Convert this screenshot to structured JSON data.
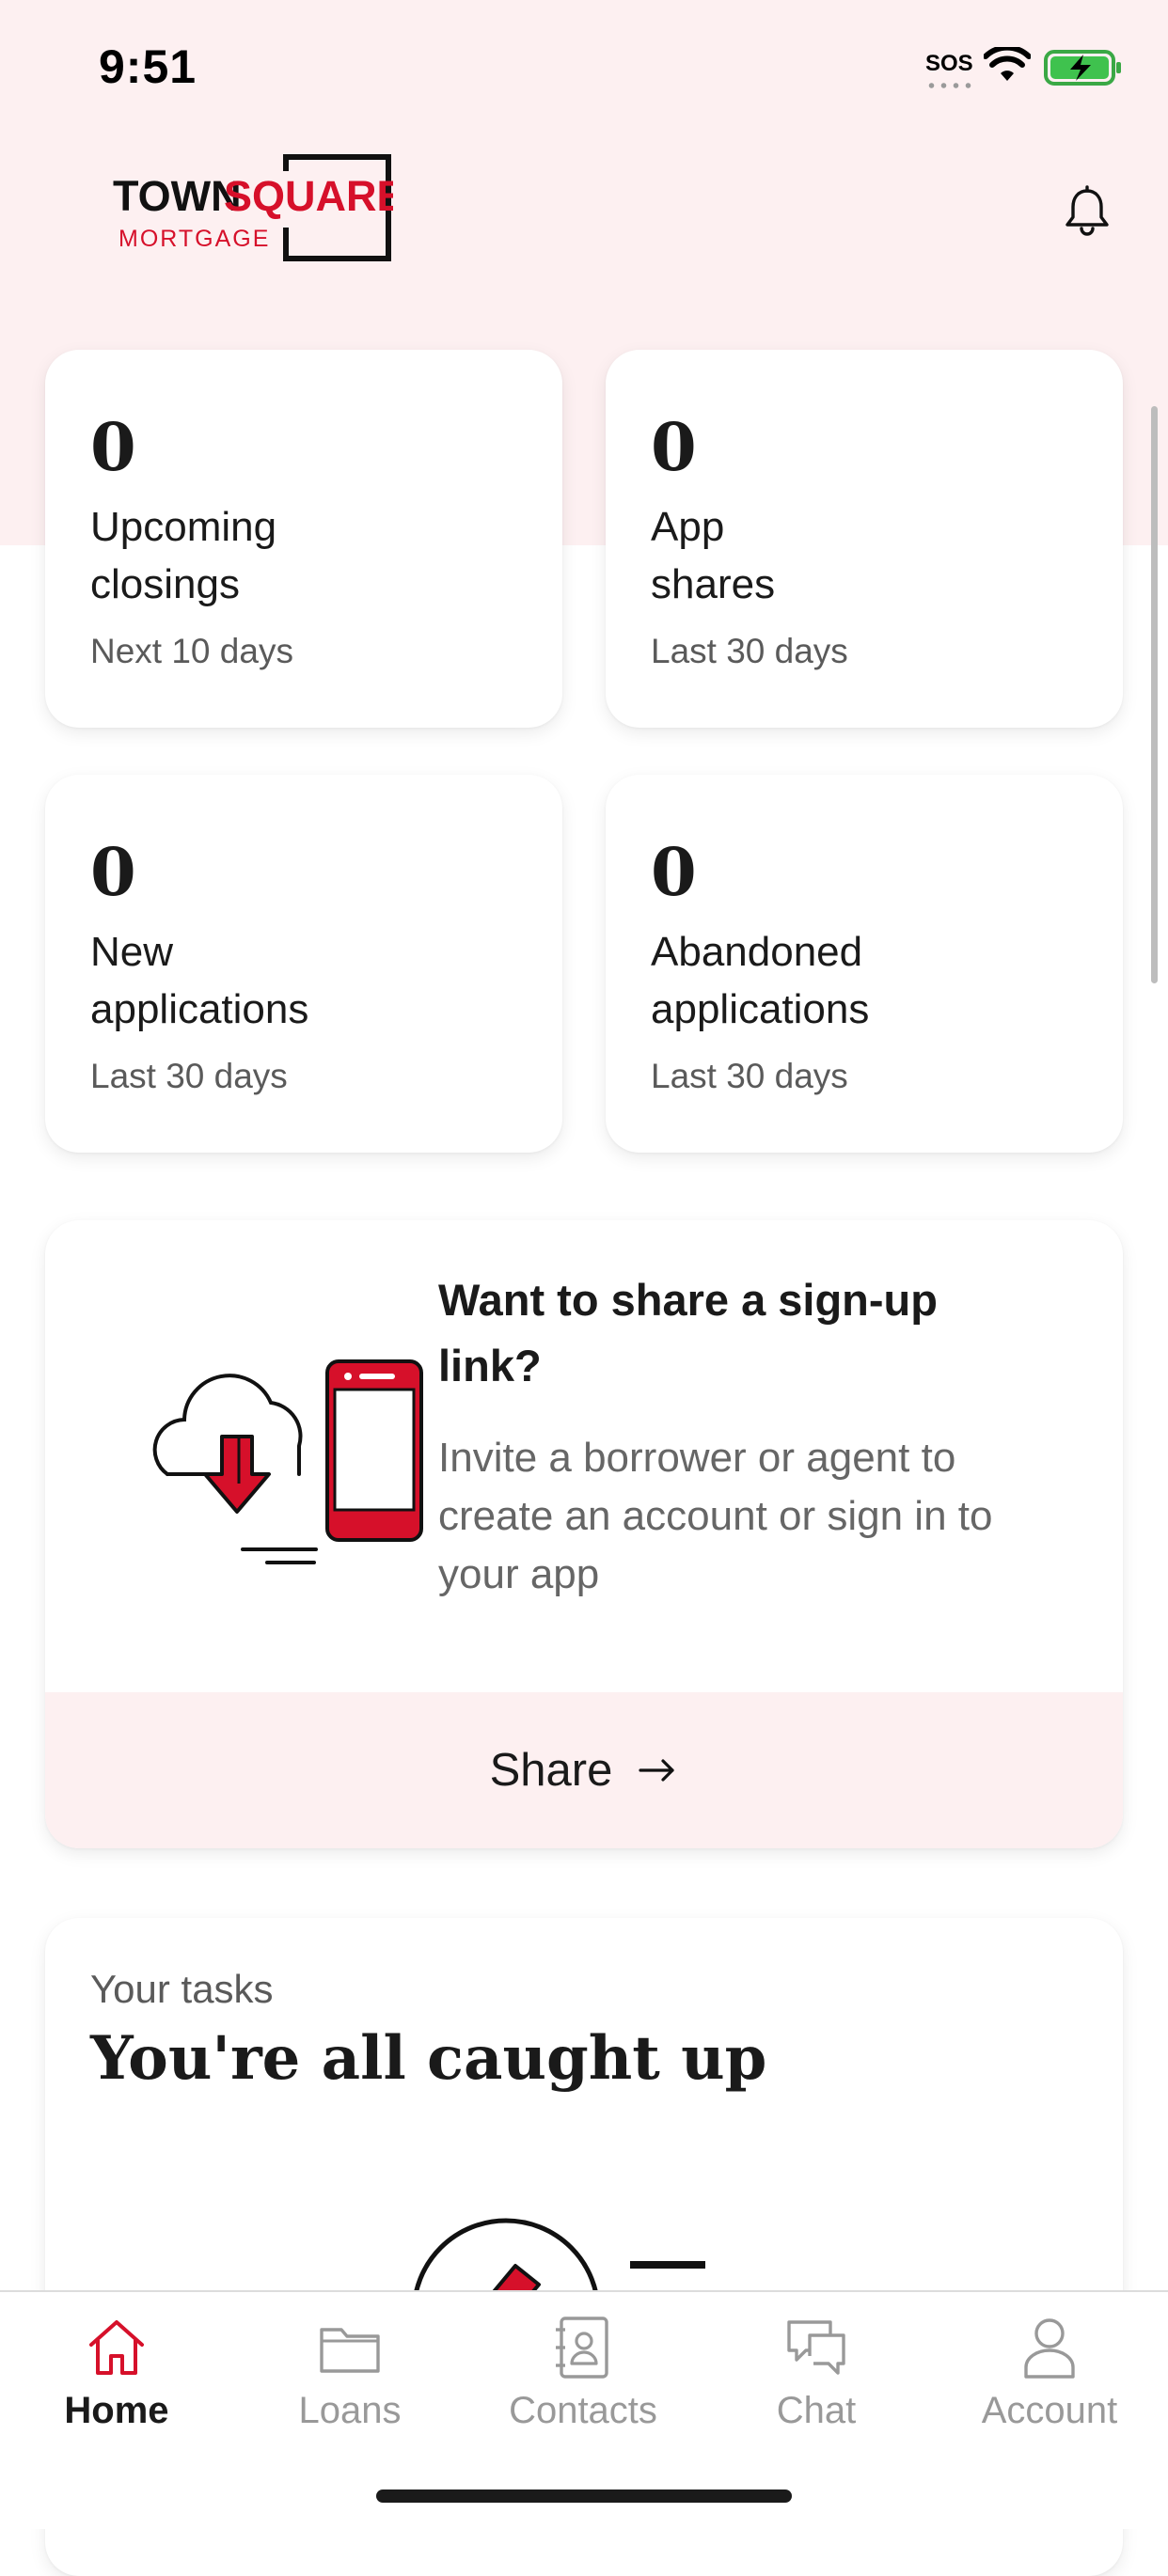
{
  "status_bar": {
    "time": "9:51",
    "sos": "SOS"
  },
  "brand": {
    "logo_word_town": "TOWN",
    "logo_word_square": "SQUARE",
    "logo_word_mortgage": "MORTGAGE",
    "accent": "#d6102a",
    "background_tint": "#fdf0f1"
  },
  "stats": [
    {
      "value": "0",
      "label": "Upcoming closings",
      "sub": "Next 10 days"
    },
    {
      "value": "0",
      "label": "App shares",
      "sub": "Last 30 days"
    },
    {
      "value": "0",
      "label": "New applications",
      "sub": "Last 30 days"
    },
    {
      "value": "0",
      "label": "Abandoned applications",
      "sub": "Last 30 days"
    }
  ],
  "share_card": {
    "title": "Want to share a sign-up link?",
    "description": "Invite a borrower or agent to create an account or sign in to your app",
    "button": "Share"
  },
  "tasks": {
    "subtitle": "Your tasks",
    "title": "You're all caught up"
  },
  "tabs": [
    {
      "label": "Home",
      "icon": "home-icon",
      "active": true
    },
    {
      "label": "Loans",
      "icon": "folder-icon",
      "active": false
    },
    {
      "label": "Contacts",
      "icon": "contacts-icon",
      "active": false
    },
    {
      "label": "Chat",
      "icon": "chat-icon",
      "active": false
    },
    {
      "label": "Account",
      "icon": "person-icon",
      "active": false
    }
  ]
}
